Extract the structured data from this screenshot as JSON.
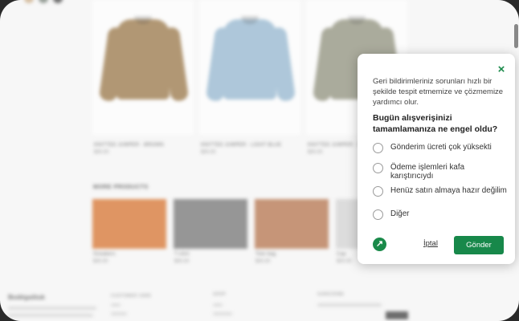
{
  "colors": {
    "accent": "#17884a",
    "overlay": "#f4f4f4"
  },
  "store": {
    "swatch_colors": [
      "#c7a780",
      "#6f7a70",
      "#3c3c3c"
    ],
    "products": [
      {
        "name": "KNITTED JUMPER - BROWN",
        "price": "$00.00",
        "color": "#94703f"
      },
      {
        "name": "KNITTED JUMPER - LIGHT BLUE",
        "price": "$00.00",
        "color": "#8fb2cc"
      },
      {
        "name": "KNITTED JUMPER - SAGE",
        "price": "$00.00",
        "color": "#8a8b76"
      }
    ],
    "more_title": "MORE PRODUCTS",
    "more": [
      {
        "name": "Sneakers",
        "price": "$00.00",
        "color": "#d36d27"
      },
      {
        "name": "T-shirt",
        "price": "$00.00",
        "color": "#6e6e6e"
      },
      {
        "name": "Tote bag",
        "price": "$00.00",
        "color": "#b06d44"
      },
      {
        "name": "Cap",
        "price": "$00.00",
        "color": "#cfcfcf"
      }
    ],
    "footer": {
      "brand": "Bodégaštuk",
      "col1": "CUSTOMER CARE",
      "col2": "SHOP",
      "col3": "SUBSCRIBE"
    }
  },
  "dialog": {
    "close_icon": "close-x-icon",
    "intro": "Geri bildirimleriniz sorunları hızlı bir şekilde tespit etmemize ve çözmemize yardımcı olur.",
    "question": "Bugün alışverişinizi tamamlamanıza ne engel oldu?",
    "options": [
      "Gönderim ücreti çok yüksekti",
      "Ödeme işlemleri kafa karıştırıcıydı",
      "Henüz satın almaya hazır değilim",
      "Diğer"
    ],
    "cancel_label": "İptal",
    "submit_label": "Gönder",
    "brand_icon": "brand-arrow-icon"
  }
}
